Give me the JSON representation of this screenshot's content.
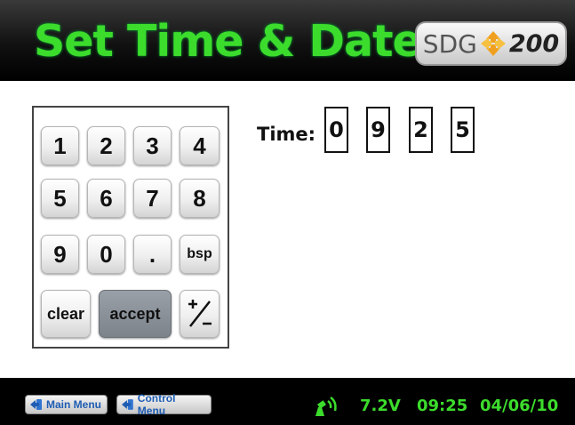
{
  "header": {
    "title": "Set Time & Date",
    "logo_left": "SDG",
    "logo_right": "200"
  },
  "keypad": {
    "keys": [
      "1",
      "2",
      "3",
      "4",
      "5",
      "6",
      "7",
      "8",
      "9",
      "0",
      ".",
      "bsp",
      "clear",
      "accept"
    ],
    "plus_minus_icon": "plus-minus-icon"
  },
  "time": {
    "label": "Time:",
    "digits": [
      "0",
      "9",
      "2",
      "5"
    ]
  },
  "footer": {
    "main_menu": "Main Menu",
    "control_menu": "Control Menu",
    "voltage": "7.2V",
    "clock": "09:25",
    "date": "04/06/10"
  },
  "colors": {
    "title_green": "#3cdc2c",
    "header_bg": "#111111",
    "footer_bg": "#000000",
    "link_blue": "#1f5db3",
    "accept_gray": "#7c838b"
  }
}
